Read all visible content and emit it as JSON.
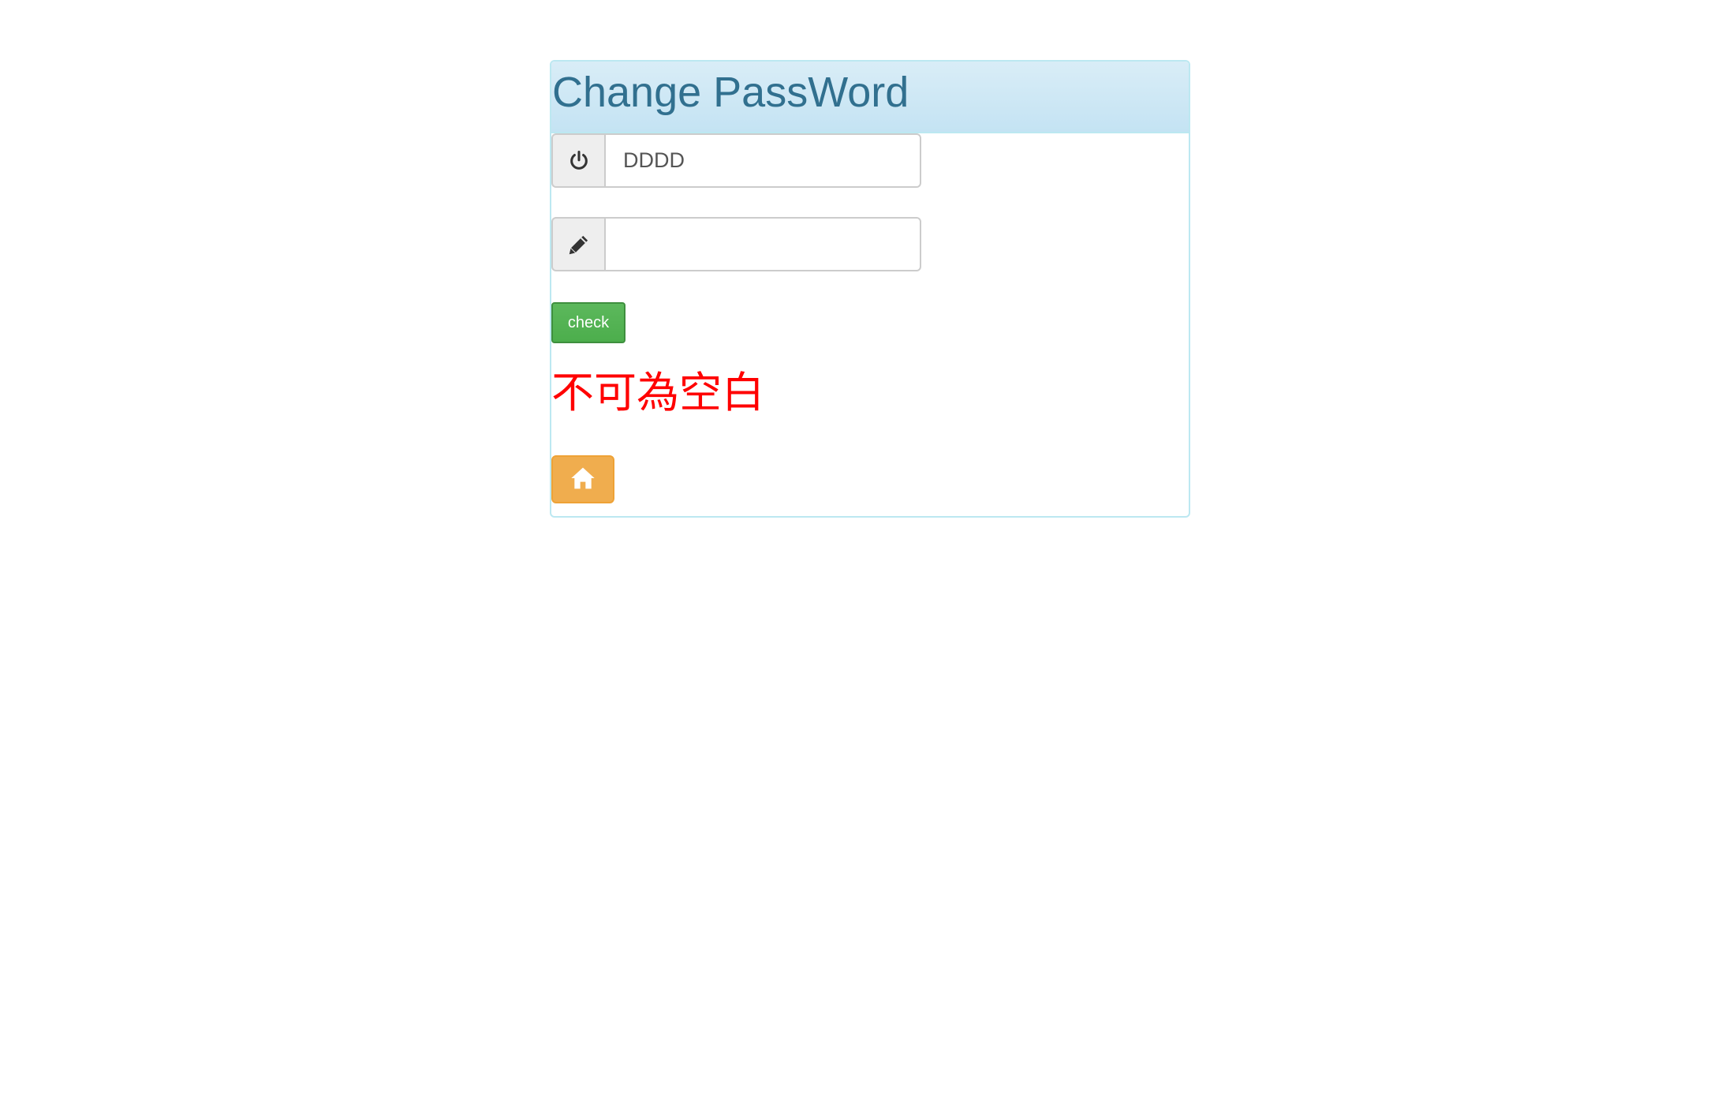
{
  "panel": {
    "title": "Change PassWord"
  },
  "form": {
    "old_password": {
      "value": "DDDD",
      "placeholder": "",
      "icon": "power-icon"
    },
    "new_password": {
      "value": "",
      "placeholder": "",
      "icon": "pencil-icon"
    },
    "check_label": "check",
    "error_message": "不可為空白"
  },
  "home_button": {
    "icon": "home-icon"
  },
  "colors": {
    "heading_bg": "#d9edf7",
    "heading_text": "#31708f",
    "panel_border": "#bce8f1",
    "check_button": "#5cb85c",
    "error_text": "#ff0000",
    "home_button": "#f0ad4e"
  }
}
